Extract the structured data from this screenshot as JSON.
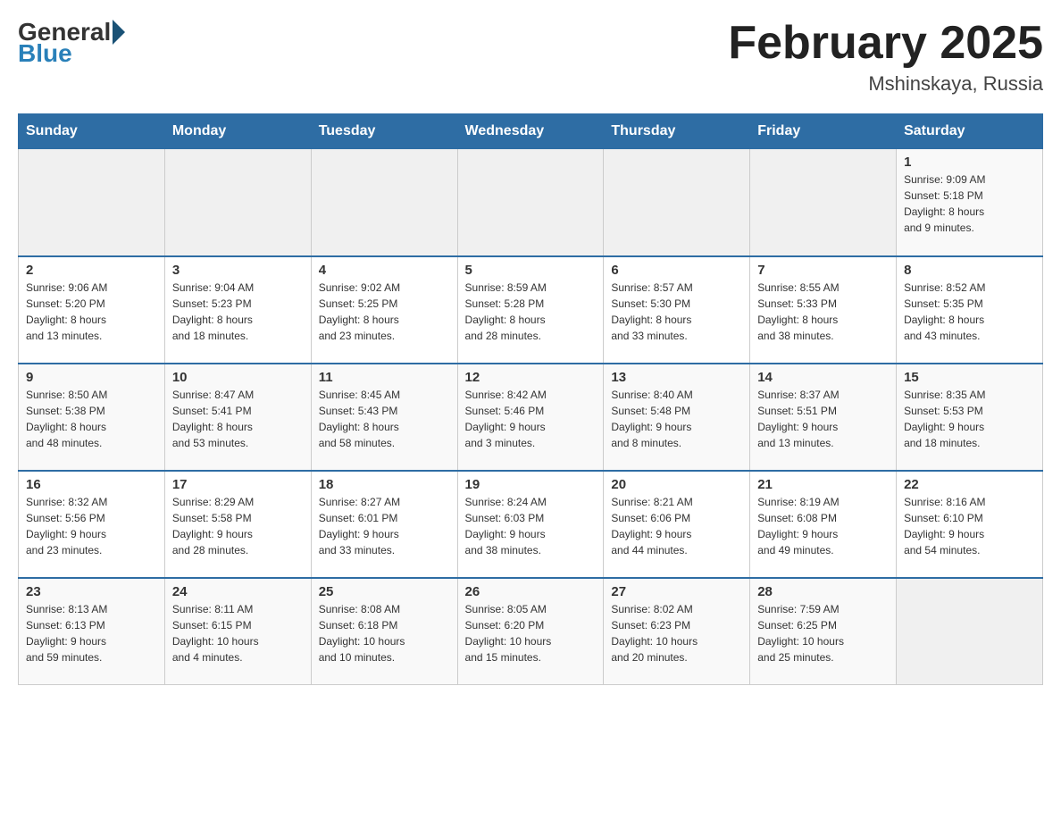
{
  "header": {
    "logo_general": "General",
    "logo_blue": "Blue",
    "title": "February 2025",
    "location": "Mshinskaya, Russia"
  },
  "days_of_week": [
    "Sunday",
    "Monday",
    "Tuesday",
    "Wednesday",
    "Thursday",
    "Friday",
    "Saturday"
  ],
  "weeks": [
    [
      {
        "day": "",
        "info": ""
      },
      {
        "day": "",
        "info": ""
      },
      {
        "day": "",
        "info": ""
      },
      {
        "day": "",
        "info": ""
      },
      {
        "day": "",
        "info": ""
      },
      {
        "day": "",
        "info": ""
      },
      {
        "day": "1",
        "info": "Sunrise: 9:09 AM\nSunset: 5:18 PM\nDaylight: 8 hours\nand 9 minutes."
      }
    ],
    [
      {
        "day": "2",
        "info": "Sunrise: 9:06 AM\nSunset: 5:20 PM\nDaylight: 8 hours\nand 13 minutes."
      },
      {
        "day": "3",
        "info": "Sunrise: 9:04 AM\nSunset: 5:23 PM\nDaylight: 8 hours\nand 18 minutes."
      },
      {
        "day": "4",
        "info": "Sunrise: 9:02 AM\nSunset: 5:25 PM\nDaylight: 8 hours\nand 23 minutes."
      },
      {
        "day": "5",
        "info": "Sunrise: 8:59 AM\nSunset: 5:28 PM\nDaylight: 8 hours\nand 28 minutes."
      },
      {
        "day": "6",
        "info": "Sunrise: 8:57 AM\nSunset: 5:30 PM\nDaylight: 8 hours\nand 33 minutes."
      },
      {
        "day": "7",
        "info": "Sunrise: 8:55 AM\nSunset: 5:33 PM\nDaylight: 8 hours\nand 38 minutes."
      },
      {
        "day": "8",
        "info": "Sunrise: 8:52 AM\nSunset: 5:35 PM\nDaylight: 8 hours\nand 43 minutes."
      }
    ],
    [
      {
        "day": "9",
        "info": "Sunrise: 8:50 AM\nSunset: 5:38 PM\nDaylight: 8 hours\nand 48 minutes."
      },
      {
        "day": "10",
        "info": "Sunrise: 8:47 AM\nSunset: 5:41 PM\nDaylight: 8 hours\nand 53 minutes."
      },
      {
        "day": "11",
        "info": "Sunrise: 8:45 AM\nSunset: 5:43 PM\nDaylight: 8 hours\nand 58 minutes."
      },
      {
        "day": "12",
        "info": "Sunrise: 8:42 AM\nSunset: 5:46 PM\nDaylight: 9 hours\nand 3 minutes."
      },
      {
        "day": "13",
        "info": "Sunrise: 8:40 AM\nSunset: 5:48 PM\nDaylight: 9 hours\nand 8 minutes."
      },
      {
        "day": "14",
        "info": "Sunrise: 8:37 AM\nSunset: 5:51 PM\nDaylight: 9 hours\nand 13 minutes."
      },
      {
        "day": "15",
        "info": "Sunrise: 8:35 AM\nSunset: 5:53 PM\nDaylight: 9 hours\nand 18 minutes."
      }
    ],
    [
      {
        "day": "16",
        "info": "Sunrise: 8:32 AM\nSunset: 5:56 PM\nDaylight: 9 hours\nand 23 minutes."
      },
      {
        "day": "17",
        "info": "Sunrise: 8:29 AM\nSunset: 5:58 PM\nDaylight: 9 hours\nand 28 minutes."
      },
      {
        "day": "18",
        "info": "Sunrise: 8:27 AM\nSunset: 6:01 PM\nDaylight: 9 hours\nand 33 minutes."
      },
      {
        "day": "19",
        "info": "Sunrise: 8:24 AM\nSunset: 6:03 PM\nDaylight: 9 hours\nand 38 minutes."
      },
      {
        "day": "20",
        "info": "Sunrise: 8:21 AM\nSunset: 6:06 PM\nDaylight: 9 hours\nand 44 minutes."
      },
      {
        "day": "21",
        "info": "Sunrise: 8:19 AM\nSunset: 6:08 PM\nDaylight: 9 hours\nand 49 minutes."
      },
      {
        "day": "22",
        "info": "Sunrise: 8:16 AM\nSunset: 6:10 PM\nDaylight: 9 hours\nand 54 minutes."
      }
    ],
    [
      {
        "day": "23",
        "info": "Sunrise: 8:13 AM\nSunset: 6:13 PM\nDaylight: 9 hours\nand 59 minutes."
      },
      {
        "day": "24",
        "info": "Sunrise: 8:11 AM\nSunset: 6:15 PM\nDaylight: 10 hours\nand 4 minutes."
      },
      {
        "day": "25",
        "info": "Sunrise: 8:08 AM\nSunset: 6:18 PM\nDaylight: 10 hours\nand 10 minutes."
      },
      {
        "day": "26",
        "info": "Sunrise: 8:05 AM\nSunset: 6:20 PM\nDaylight: 10 hours\nand 15 minutes."
      },
      {
        "day": "27",
        "info": "Sunrise: 8:02 AM\nSunset: 6:23 PM\nDaylight: 10 hours\nand 20 minutes."
      },
      {
        "day": "28",
        "info": "Sunrise: 7:59 AM\nSunset: 6:25 PM\nDaylight: 10 hours\nand 25 minutes."
      },
      {
        "day": "",
        "info": ""
      }
    ]
  ]
}
